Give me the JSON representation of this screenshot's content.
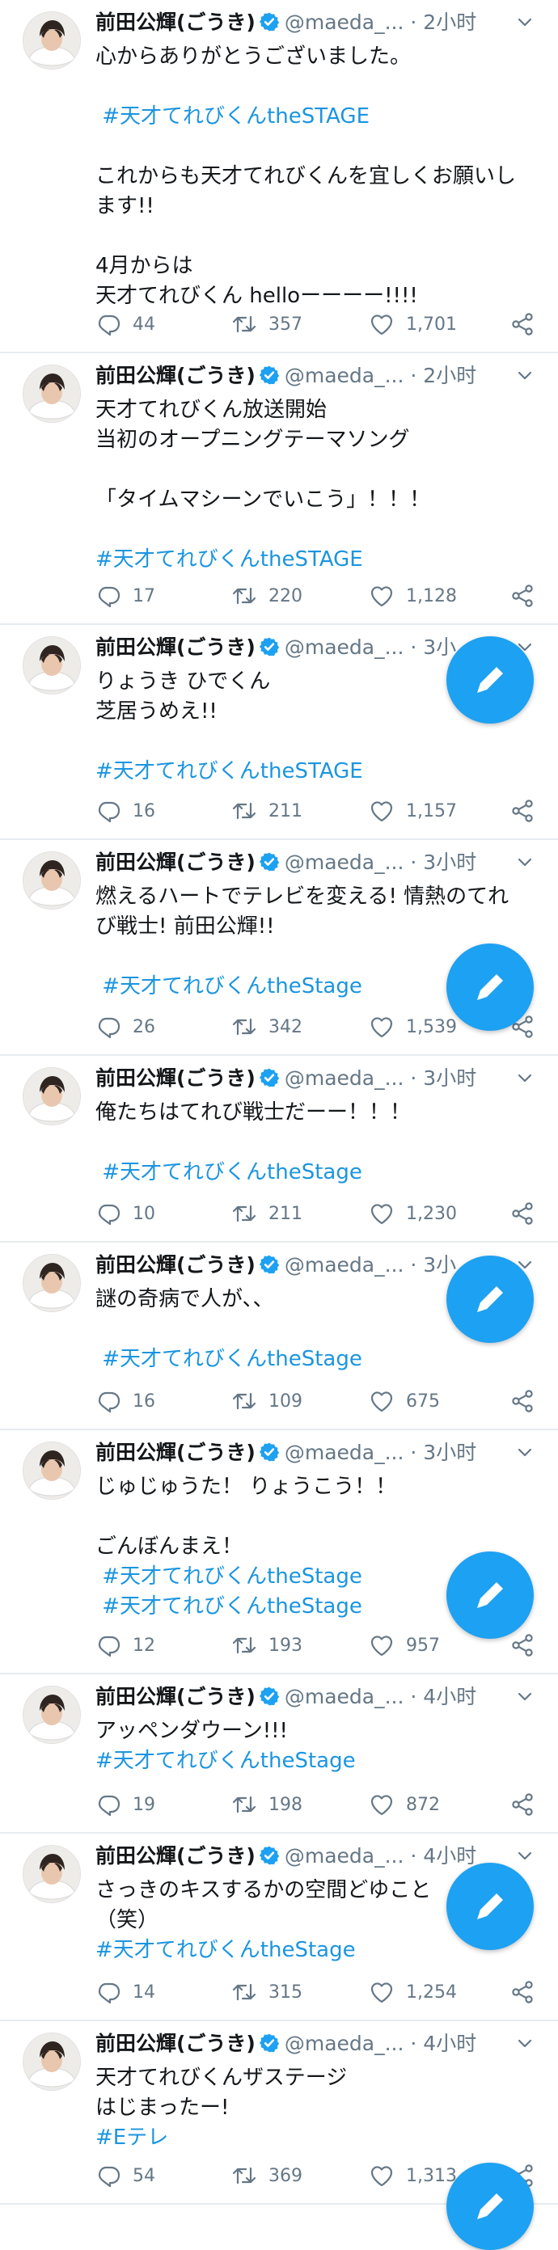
{
  "colors": {
    "link": "#1b95e0",
    "secondary": "#657786",
    "fab": "#1da1f2",
    "separator": "#e6ecf0"
  },
  "icons": {
    "verified": "verified-badge-icon",
    "more": "chevron-down-icon",
    "reply": "reply-icon",
    "retweet": "retweet-icon",
    "like": "heart-icon",
    "share": "share-icon",
    "compose": "compose-tweet-icon"
  },
  "tweets": [
    {
      "name": "前田公輝(ごうき)",
      "handle": "@maeda_...",
      "time": "· 2小时",
      "lines": [
        "心からありがとうございました。",
        "",
        " #天才てれびくんtheSTAGE",
        "",
        "これからも天才てれびくんを宜しくお願いし",
        "ます!!",
        "",
        "4月からは",
        "天才てれびくん helloーーーー!!!!"
      ],
      "tag_lines": [
        2
      ],
      "replies": "44",
      "retweets": "357",
      "likes": "1,701"
    },
    {
      "name": "前田公輝(ごうき)",
      "handle": "@maeda_...",
      "time": "· 2小时",
      "lines": [
        "天才てれびくん放送開始",
        "当初のオープニングテーマソング",
        "",
        "「タイムマシーンでいこう」！！！",
        "",
        "#天才てれびくんtheSTAGE"
      ],
      "tag_lines": [
        5
      ],
      "replies": "17",
      "retweets": "220",
      "likes": "1,128"
    },
    {
      "name": "前田公輝(ごうき)",
      "handle": "@maeda_...",
      "time": "· 3小",
      "lines": [
        "りょうき ひでくん",
        "芝居うめえ!!",
        "",
        "#天才てれびくんtheSTAGE"
      ],
      "tag_lines": [
        3
      ],
      "replies": "16",
      "retweets": "211",
      "likes": "1,157"
    },
    {
      "name": "前田公輝(ごうき)",
      "handle": "@maeda_...",
      "time": "· 3小时",
      "lines": [
        "燃えるハートでテレビを変える! 情熱のてれ",
        "び戦士! 前田公輝!!",
        "",
        " #天才てれびくんtheStage"
      ],
      "tag_lines": [
        3
      ],
      "replies": "26",
      "retweets": "342",
      "likes": "1,539"
    },
    {
      "name": "前田公輝(ごうき)",
      "handle": "@maeda_...",
      "time": "· 3小时",
      "lines": [
        "俺たちはてれび戦士だーー！！！",
        "",
        " #天才てれびくんtheStage"
      ],
      "tag_lines": [
        2
      ],
      "replies": "10",
      "retweets": "211",
      "likes": "1,230"
    },
    {
      "name": "前田公輝(ごうき)",
      "handle": "@maeda_...",
      "time": "· 3小",
      "lines": [
        "謎の奇病で人が、、",
        "",
        " #天才てれびくんtheStage"
      ],
      "tag_lines": [
        2
      ],
      "replies": "16",
      "retweets": "109",
      "likes": "675"
    },
    {
      "name": "前田公輝(ごうき)",
      "handle": "@maeda_...",
      "time": "· 3小时",
      "lines": [
        "じゅじゅうた！ りょうこう！！",
        "",
        "ごんぼんまえ！",
        " #天才てれびくんtheStage",
        " #天才てれびくんtheStage"
      ],
      "tag_lines": [
        3,
        4
      ],
      "replies": "12",
      "retweets": "193",
      "likes": "957"
    },
    {
      "name": "前田公輝(ごうき)",
      "handle": "@maeda_...",
      "time": "· 4小时",
      "lines": [
        "アッペンダウーン!!!",
        "#天才てれびくんtheStage"
      ],
      "tag_lines": [
        1
      ],
      "replies": "19",
      "retweets": "198",
      "likes": "872"
    },
    {
      "name": "前田公輝(ごうき)",
      "handle": "@maeda_...",
      "time": "· 4小时",
      "lines": [
        "さっきのキスするかの空間どゆこと",
        "（笑）",
        "#天才てれびくんtheStage"
      ],
      "tag_lines": [
        2
      ],
      "replies": "14",
      "retweets": "315",
      "likes": "1,254"
    },
    {
      "name": "前田公輝(ごうき)",
      "handle": "@maeda_...",
      "time": "· 4小时",
      "lines": [
        "天才てれびくんザステージ",
        "はじまったー!",
        "#Eテレ"
      ],
      "tag_lines": [
        2
      ],
      "replies": "54",
      "retweets": "369",
      "likes": "1,313"
    }
  ]
}
